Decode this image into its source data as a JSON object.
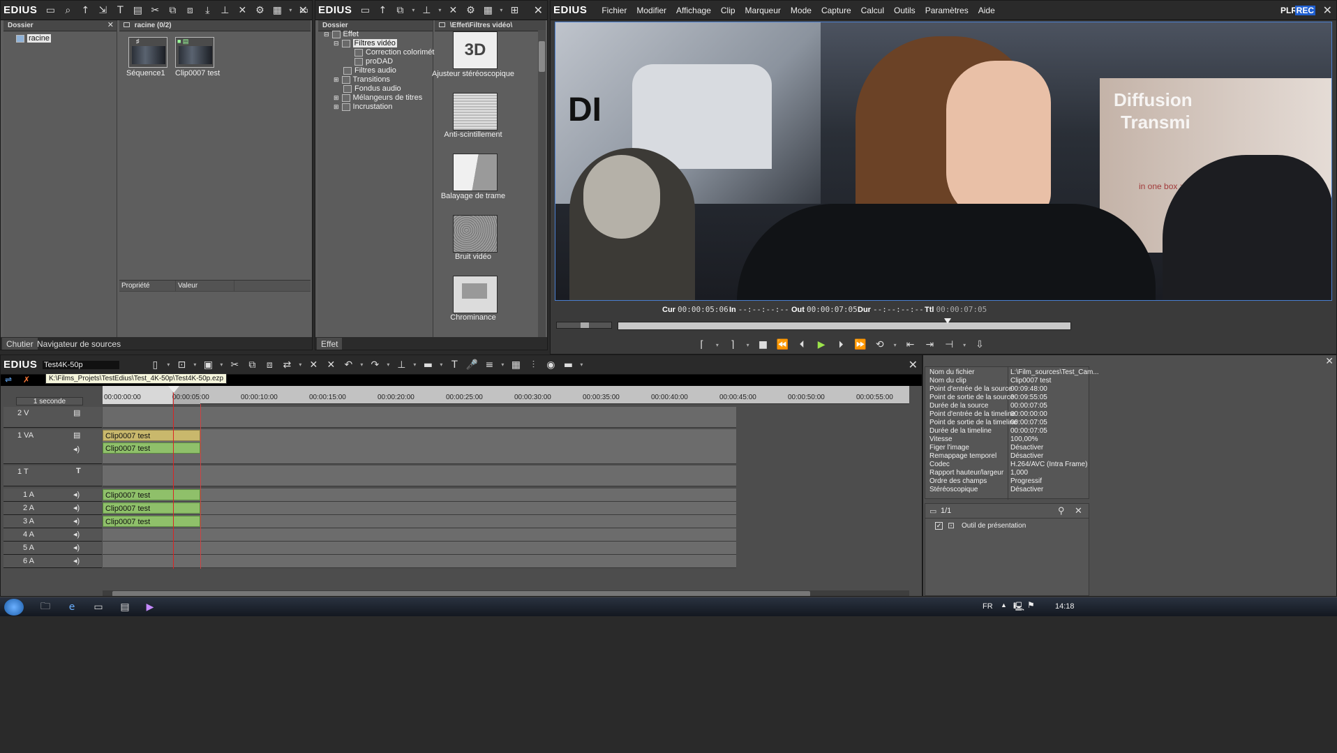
{
  "bin": {
    "logo": "EDIUS",
    "folder_header": "Dossier",
    "root_folder": "racine",
    "content_header": "racine (0/2)",
    "clips": [
      {
        "name": "Séquence1"
      },
      {
        "name": "Clip0007 test"
      }
    ],
    "property_col": "Propriété",
    "value_col": "Valeur",
    "tabs": [
      "Chutier",
      "Navigateur de sources"
    ]
  },
  "effects": {
    "logo": "EDIUS",
    "folder_header": "Dossier",
    "path_header": "\\Effet\\Filtres vidéo\\",
    "tree": [
      {
        "label": "Effet"
      },
      {
        "label": "Filtres vidéo"
      },
      {
        "label": "Correction colorimétrique"
      },
      {
        "label": "proDAD"
      },
      {
        "label": "Filtres audio"
      },
      {
        "label": "Transitions"
      },
      {
        "label": "Fondus audio"
      },
      {
        "label": "Mélangeurs de titres"
      },
      {
        "label": "Incrustation"
      }
    ],
    "items": [
      {
        "label": "Ajusteur stéréoscopique",
        "thumb": "3D"
      },
      {
        "label": "Anti-scintillement"
      },
      {
        "label": "Balayage de trame"
      },
      {
        "label": "Bruit vidéo"
      },
      {
        "label": "Chrominance"
      }
    ],
    "tab": "Effet"
  },
  "player": {
    "logo": "EDIUS",
    "menu": [
      "Fichier",
      "Modifier",
      "Affichage",
      "Clip",
      "Marqueur",
      "Mode",
      "Capture",
      "Calcul",
      "Outils",
      "Paramètres",
      "Aide"
    ],
    "plr": "PLR",
    "rec": "REC",
    "cur_label": "Cur",
    "cur": "00:00:05:06",
    "in_label": "In",
    "in": "--:--:--:--",
    "out_label": "Out",
    "out": "00:00:07:05",
    "dur_label": "Dur",
    "dur": "--:--:--:--",
    "ttl_label": "Ttl",
    "ttl": "00:00:07:05",
    "overlay_text_1": "Diffusion",
    "overlay_text_2": "Transmi",
    "overlay_text_3": "in one box :",
    "overlay_text_4": "DI",
    "position_fraction": 0.73
  },
  "timeline": {
    "logo": "EDIUS",
    "project_name": "Test4K-50p",
    "tooltip": "K:\\Films_Projets\\TestEdius\\Test_4K-50p\\Test4K-50p.ezp",
    "scale": "1 seconde",
    "ruler": [
      "00:00:00:00",
      "00:00:05:00",
      "00:00:10:00",
      "00:00:15:00",
      "00:00:20:00",
      "00:00:25:00",
      "00:00:30:00",
      "00:00:35:00",
      "00:00:40:00",
      "00:00:45:00",
      "00:00:50:00",
      "00:00:55:00"
    ],
    "tracks": [
      {
        "name": "2 V"
      },
      {
        "name": "1 VA",
        "clip_v": "Clip0007 test",
        "clip_a": "Clip0007 test"
      },
      {
        "name": "1 T"
      },
      {
        "name": "1 A",
        "clip": "Clip0007 test"
      },
      {
        "name": "2 A",
        "clip": "Clip0007 test"
      },
      {
        "name": "3 A",
        "clip": "Clip0007 test"
      },
      {
        "name": "4 A"
      },
      {
        "name": "5 A"
      },
      {
        "name": "6 A"
      }
    ]
  },
  "info": {
    "rows": [
      {
        "k": "Nom du fichier",
        "v": "L:\\Film_sources\\Test_Cam..."
      },
      {
        "k": "Nom du clip",
        "v": "Clip0007 test"
      },
      {
        "k": "Point d'entrée de la source",
        "v": "00:09:48:00"
      },
      {
        "k": "Point de sortie de la source",
        "v": "00:09:55:05"
      },
      {
        "k": "Durée de la source",
        "v": "00:00:07:05"
      },
      {
        "k": "Point d'entrée de la timeline",
        "v": "00:00:00:00"
      },
      {
        "k": "Point de sortie de la timeline",
        "v": "00:00:07:05"
      },
      {
        "k": "Durée de la timeline",
        "v": "00:00:07:05"
      },
      {
        "k": "Vitesse",
        "v": "100,00%"
      },
      {
        "k": "Figer l'image",
        "v": "Désactiver"
      },
      {
        "k": "Remappage temporel",
        "v": "Désactiver"
      },
      {
        "k": "Codec",
        "v": "H.264/AVC (Intra Frame)"
      },
      {
        "k": "Rapport hauteur/largeur",
        "v": "1,000"
      },
      {
        "k": "Ordre des champs",
        "v": "Progressif"
      },
      {
        "k": "Stéréoscopique",
        "v": "Désactiver"
      }
    ],
    "page": "1/1",
    "filter_item": "Outil de présentation"
  },
  "taskbar": {
    "lang": "FR",
    "time": "14:18"
  }
}
